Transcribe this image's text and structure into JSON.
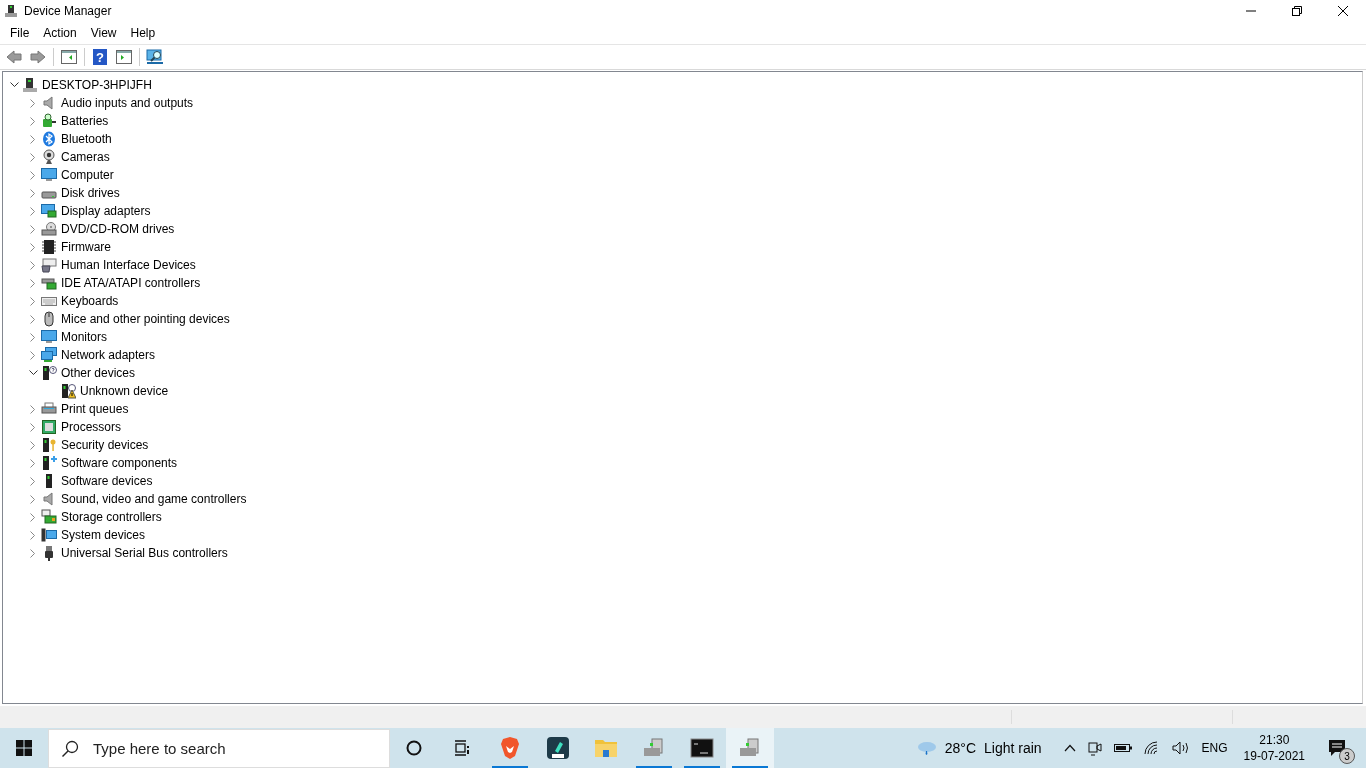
{
  "window": {
    "title": "Device Manager"
  },
  "menu": [
    "File",
    "Action",
    "View",
    "Help"
  ],
  "toolbar": {
    "help_glyph": "?"
  },
  "tree": {
    "label": "DESKTOP-3HPIJFH",
    "expanded": true,
    "children": [
      {
        "label": "Audio inputs and outputs",
        "expanded": false
      },
      {
        "label": "Batteries",
        "expanded": false
      },
      {
        "label": "Bluetooth",
        "expanded": false
      },
      {
        "label": "Cameras",
        "expanded": false
      },
      {
        "label": "Computer",
        "expanded": false
      },
      {
        "label": "Disk drives",
        "expanded": false
      },
      {
        "label": "Display adapters",
        "expanded": false
      },
      {
        "label": "DVD/CD-ROM drives",
        "expanded": false
      },
      {
        "label": "Firmware",
        "expanded": false
      },
      {
        "label": "Human Interface Devices",
        "expanded": false
      },
      {
        "label": "IDE ATA/ATAPI controllers",
        "expanded": false
      },
      {
        "label": "Keyboards",
        "expanded": false
      },
      {
        "label": "Mice and other pointing devices",
        "expanded": false
      },
      {
        "label": "Monitors",
        "expanded": false
      },
      {
        "label": "Network adapters",
        "expanded": false
      },
      {
        "label": "Other devices",
        "expanded": true,
        "children": [
          {
            "label": "Unknown device"
          }
        ]
      },
      {
        "label": "Print queues",
        "expanded": false
      },
      {
        "label": "Processors",
        "expanded": false
      },
      {
        "label": "Security devices",
        "expanded": false
      },
      {
        "label": "Software components",
        "expanded": false
      },
      {
        "label": "Software devices",
        "expanded": false
      },
      {
        "label": "Sound, video and game controllers",
        "expanded": false
      },
      {
        "label": "Storage controllers",
        "expanded": false
      },
      {
        "label": "System devices",
        "expanded": false
      },
      {
        "label": "Universal Serial Bus controllers",
        "expanded": false
      }
    ]
  },
  "taskbar": {
    "search": {
      "placeholder": "Type here to search"
    },
    "apps": [
      {
        "running": true,
        "selected": false
      },
      {
        "running": false,
        "selected": false
      },
      {
        "running": false,
        "selected": false
      },
      {
        "running": true,
        "selected": false
      },
      {
        "running": true,
        "selected": false
      },
      {
        "running": true,
        "selected": true
      }
    ],
    "weather": {
      "temperature": "28°C",
      "condition": "Light rain"
    },
    "language": "ENG",
    "time": "21:30",
    "date": "19-07-2021",
    "notifications": "3"
  }
}
